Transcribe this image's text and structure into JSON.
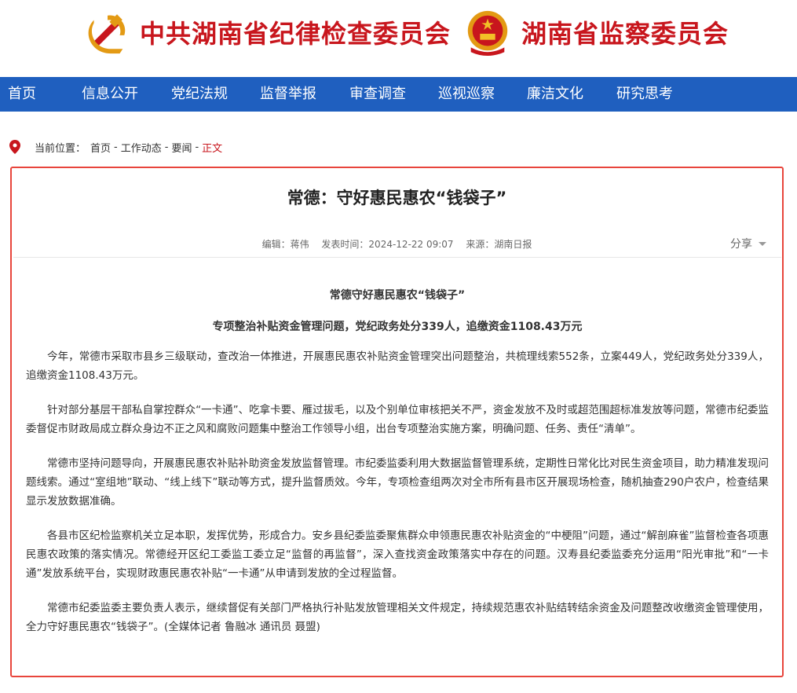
{
  "header": {
    "title_cpc": "中共湖南省纪律检查委员会",
    "title_supervision": "湖南省监察委员会",
    "emblem_party_color": "#c8161d",
    "emblem_state_color": "#c8161d"
  },
  "nav": {
    "items": [
      "首页",
      "信息公开",
      "党纪法规",
      "监督举报",
      "审查调查",
      "巡视巡察",
      "廉洁文化",
      "研究思考"
    ]
  },
  "breadcrumb": {
    "prefix": "当前位置：",
    "items": [
      "首页",
      "工作动态",
      "要闻"
    ],
    "current": "正文",
    "separator": "-"
  },
  "article": {
    "title": "常德：守好惠民惠农“钱袋子”",
    "editor": "编辑：蒋伟",
    "publish_time": "发表时间：2024-12-22 09:07",
    "source": "来源：湖南日报",
    "share_label": "分享",
    "subtitle": "常德守好惠民惠农“钱袋子”",
    "subheading": "专项整治补贴资金管理问题，党纪政务处分339人，追缴资金1108.43万元",
    "paragraphs": [
      "今年，常德市采取市县乡三级联动，查改治一体推进，开展惠民惠农补贴资金管理突出问题整治，共梳理线索552条，立案449人，党纪政务处分339人，追缴资金1108.43万元。",
      "针对部分基层干部私自掌控群众“一卡通”、吃拿卡要、雁过拔毛，以及个别单位审核把关不严，资金发放不及时或超范围超标准发放等问题，常德市纪委监委督促市财政局成立群众身边不正之风和腐败问题集中整治工作领导小组，出台专项整治实施方案，明确问题、任务、责任“清单”。",
      "常德市坚持问题导向，开展惠民惠农补贴补助资金发放监督管理。市纪委监委利用大数据监督管理系统，定期性日常化比对民生资金项目，助力精准发现问题线索。通过“室组地”联动、“线上线下”联动等方式，提升监督质效。今年，专项检查组两次对全市所有县市区开展现场检查，随机抽查290户农户，检查结果显示发放数据准确。",
      "各县市区纪检监察机关立足本职，发挥优势，形成合力。安乡县纪委监委聚焦群众申领惠民惠农补贴资金的“中梗阻”问题，通过“解剖麻雀”监督检查各项惠民惠农政策的落实情况。常德经开区纪工委监工委立足“监督的再监督”，深入查找资金政策落实中存在的问题。汉寿县纪委监委充分运用“阳光审批”和“一卡通”发放系统平台，实现财政惠民惠农补贴“一卡通”从申请到发放的全过程监督。",
      "常德市纪委监委主要负责人表示，继续督促有关部门严格执行补贴发放管理相关文件规定，持续规范惠农补贴结转结余资金及问题整改收缴资金管理使用，全力守好惠民惠农“钱袋子”。(全媒体记者 鲁融冰 通讯员 聂盟)"
    ]
  }
}
